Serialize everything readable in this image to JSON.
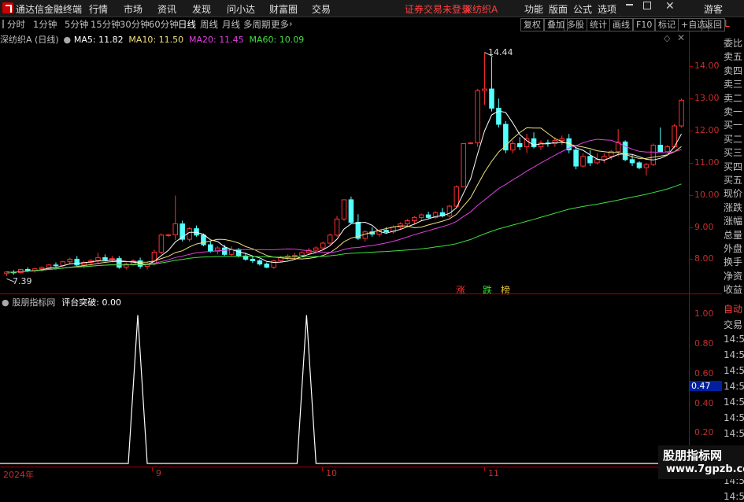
{
  "menubar": {
    "app_title": "通达信金融终端",
    "items": [
      "行情",
      "市场",
      "资讯",
      "发现",
      "问小达",
      "财富圈",
      "交易"
    ],
    "notice": "证券交易未登录",
    "stock_tab": "深纺织A",
    "right_items": [
      "功能",
      "版面",
      "公式",
      "选项"
    ],
    "user": "游客"
  },
  "toolbar": {
    "periods": [
      "分时",
      "1分钟",
      "5分钟",
      "15分钟",
      "30分钟",
      "60分钟",
      "日线",
      "周线",
      "月线",
      "多周期",
      "更多"
    ],
    "selected": "日线",
    "right_buttons": [
      "复权",
      "叠加",
      "多股",
      "统计",
      "画线",
      "F10",
      "标记",
      "+自选",
      "返回"
    ]
  },
  "main_chart": {
    "stock_label": "深纺织A (日线)",
    "ma": [
      {
        "name": "MA5",
        "value": "11.82",
        "color": "#ffffff"
      },
      {
        "name": "MA10",
        "value": "11.50",
        "color": "#f0e080"
      },
      {
        "name": "MA20",
        "value": "11.45",
        "color": "#e040e0"
      },
      {
        "name": "MA60",
        "value": "10.09",
        "color": "#40e040"
      }
    ],
    "high_label": "14.44",
    "low_label": "7.39",
    "markers": [
      {
        "text": "涨",
        "color": "#ff3030"
      },
      {
        "text": "跌",
        "color": "#30e030"
      },
      {
        "text": "榜",
        "color": "#e0c030"
      }
    ]
  },
  "indicator": {
    "name": "股朋指标网",
    "title": "评台突破",
    "value": "0.00",
    "current_label": "0.47"
  },
  "right_panel": {
    "items": [
      "委比",
      "卖五",
      "卖四",
      "卖三",
      "卖二",
      "卖一",
      "买一",
      "买二",
      "买三",
      "买四",
      "买五",
      "现价",
      "涨跌",
      "涨幅",
      "总量",
      "外盘",
      "换手",
      "净资",
      "收益"
    ],
    "lower_items": [
      "自动",
      "交易",
      "14:56",
      "14:56",
      "14:56",
      "14:56",
      "14:56",
      "14:56",
      "14:56",
      "14:56",
      "14:56",
      "14:56",
      "14:56"
    ],
    "corner": "L"
  },
  "bottom_axis": {
    "labels": [
      "2024年",
      "9",
      "10",
      "11"
    ]
  },
  "watermark": {
    "line1": "股朋指标网",
    "line2": "www.7gpzb.com"
  },
  "chart_data": [
    {
      "type": "candlestick",
      "title": "深纺织A (日线)",
      "ylim": [
        7.3,
        14.6
      ],
      "yticks": [
        8.0,
        9.0,
        10.0,
        11.0,
        12.0,
        13.0,
        14.0
      ],
      "high": 14.44,
      "low": 7.39,
      "candles": [
        [
          7.55,
          7.62,
          7.48,
          7.6
        ],
        [
          7.6,
          7.66,
          7.52,
          7.58
        ],
        [
          7.58,
          7.7,
          7.55,
          7.68
        ],
        [
          7.68,
          7.75,
          7.6,
          7.65
        ],
        [
          7.65,
          7.72,
          7.58,
          7.7
        ],
        [
          7.7,
          7.78,
          7.62,
          7.74
        ],
        [
          7.74,
          7.85,
          7.7,
          7.82
        ],
        [
          7.82,
          7.9,
          7.75,
          7.8
        ],
        [
          7.8,
          7.95,
          7.76,
          7.92
        ],
        [
          7.92,
          8.05,
          7.85,
          8.0
        ],
        [
          8.0,
          8.1,
          7.78,
          7.82
        ],
        [
          7.82,
          7.95,
          7.72,
          7.9
        ],
        [
          7.9,
          8.0,
          7.8,
          7.96
        ],
        [
          7.96,
          8.2,
          7.88,
          8.05
        ],
        [
          8.05,
          8.15,
          7.95,
          7.98
        ],
        [
          7.98,
          8.1,
          7.9,
          8.02
        ],
        [
          8.02,
          8.1,
          7.7,
          7.75
        ],
        [
          7.75,
          7.9,
          7.68,
          7.85
        ],
        [
          7.85,
          8.0,
          7.8,
          7.95
        ],
        [
          7.95,
          8.05,
          7.7,
          7.78
        ],
        [
          7.78,
          7.9,
          7.68,
          7.85
        ],
        [
          7.85,
          8.3,
          7.8,
          8.22
        ],
        [
          8.22,
          8.8,
          8.15,
          8.75
        ],
        [
          8.75,
          8.78,
          8.7,
          8.76
        ],
        [
          8.76,
          9.98,
          8.6,
          9.1
        ],
        [
          9.1,
          9.2,
          8.55,
          8.62
        ],
        [
          8.62,
          9.0,
          8.55,
          8.95
        ],
        [
          8.95,
          9.05,
          8.7,
          8.75
        ],
        [
          8.75,
          8.8,
          8.4,
          8.45
        ],
        [
          8.45,
          8.55,
          8.2,
          8.25
        ],
        [
          8.25,
          8.4,
          8.15,
          8.35
        ],
        [
          8.35,
          8.45,
          8.1,
          8.15
        ],
        [
          8.15,
          8.4,
          8.1,
          8.3
        ],
        [
          8.3,
          8.35,
          8.05,
          8.1
        ],
        [
          8.1,
          8.2,
          7.95,
          8.0
        ],
        [
          8.0,
          8.1,
          7.88,
          7.95
        ],
        [
          7.95,
          8.0,
          7.8,
          7.85
        ],
        [
          7.85,
          7.9,
          7.72,
          7.75
        ],
        [
          7.75,
          7.98,
          7.7,
          7.95
        ],
        [
          7.95,
          8.1,
          7.9,
          8.05
        ],
        [
          8.05,
          8.15,
          7.98,
          8.1
        ],
        [
          8.1,
          8.2,
          8.02,
          8.12
        ],
        [
          8.12,
          8.25,
          8.05,
          8.2
        ],
        [
          8.2,
          8.35,
          8.15,
          8.28
        ],
        [
          8.28,
          8.4,
          8.2,
          8.35
        ],
        [
          8.35,
          8.55,
          8.3,
          8.5
        ],
        [
          8.5,
          8.8,
          8.45,
          8.75
        ],
        [
          8.75,
          9.35,
          8.7,
          9.25
        ],
        [
          9.25,
          9.8,
          9.2,
          9.85
        ],
        [
          9.85,
          9.95,
          9.1,
          9.15
        ],
        [
          9.15,
          9.4,
          8.6,
          8.65
        ],
        [
          8.65,
          8.9,
          8.55,
          8.85
        ],
        [
          8.85,
          9.0,
          8.7,
          8.78
        ],
        [
          8.78,
          8.92,
          8.7,
          8.9
        ],
        [
          8.9,
          9.0,
          8.8,
          8.85
        ],
        [
          8.85,
          9.05,
          8.8,
          9.0
        ],
        [
          9.0,
          9.15,
          8.92,
          9.1
        ],
        [
          9.1,
          9.25,
          9.0,
          9.2
        ],
        [
          9.2,
          9.35,
          9.1,
          9.3
        ],
        [
          9.3,
          9.42,
          9.2,
          9.38
        ],
        [
          9.38,
          9.48,
          9.25,
          9.3
        ],
        [
          9.3,
          9.5,
          9.25,
          9.45
        ],
        [
          9.45,
          9.6,
          9.3,
          9.35
        ],
        [
          9.35,
          9.7,
          9.3,
          9.65
        ],
        [
          9.65,
          10.3,
          9.6,
          10.25
        ],
        [
          10.25,
          10.4,
          11.6,
          11.6
        ],
        [
          11.6,
          11.65,
          11.6,
          11.62
        ],
        [
          11.62,
          13.3,
          11.5,
          13.25
        ],
        [
          13.25,
          14.44,
          12.8,
          13.3
        ],
        [
          13.3,
          14.3,
          12.6,
          12.7
        ],
        [
          12.7,
          13.0,
          12.1,
          12.2
        ],
        [
          12.2,
          12.3,
          11.3,
          11.4
        ],
        [
          11.4,
          11.7,
          11.3,
          11.6
        ],
        [
          11.6,
          11.8,
          11.4,
          11.5
        ],
        [
          11.5,
          11.9,
          11.3,
          11.75
        ],
        [
          11.75,
          11.95,
          11.45,
          11.5
        ],
        [
          11.5,
          11.7,
          11.4,
          11.62
        ],
        [
          11.62,
          11.72,
          11.5,
          11.6
        ],
        [
          11.6,
          11.8,
          11.5,
          11.7
        ],
        [
          11.7,
          11.85,
          11.55,
          11.75
        ],
        [
          11.75,
          11.9,
          11.3,
          11.4
        ],
        [
          11.4,
          11.5,
          10.8,
          10.9
        ],
        [
          10.9,
          11.3,
          10.85,
          11.2
        ],
        [
          11.2,
          11.4,
          10.9,
          11.0
        ],
        [
          11.0,
          11.3,
          10.95,
          11.1
        ],
        [
          11.1,
          11.3,
          11.0,
          11.2
        ],
        [
          11.2,
          11.4,
          11.1,
          11.35
        ],
        [
          11.35,
          12.05,
          11.2,
          11.65
        ],
        [
          11.65,
          11.7,
          11.05,
          11.1
        ],
        [
          11.1,
          11.25,
          10.9,
          11.0
        ],
        [
          11.0,
          11.05,
          10.8,
          10.85
        ],
        [
          10.85,
          11.0,
          10.6,
          10.95
        ],
        [
          10.95,
          11.6,
          10.9,
          11.55
        ],
        [
          11.55,
          12.1,
          11.45,
          11.35
        ],
        [
          11.35,
          11.55,
          11.3,
          11.5
        ],
        [
          11.5,
          12.2,
          11.45,
          12.15
        ],
        [
          12.15,
          13.0,
          12.1,
          12.95
        ]
      ],
      "ma5_end": 11.82,
      "ma10_end": 11.5,
      "ma20_end": 11.45,
      "ma60_end": 10.09
    },
    {
      "type": "line",
      "title": "评台突破",
      "ylim": [
        0.0,
        1.05
      ],
      "yticks": [
        0.2,
        0.4,
        0.6,
        0.8,
        1.0
      ],
      "spikes": [
        {
          "position": 0.2,
          "value": 1.0
        },
        {
          "position": 0.445,
          "value": 1.0
        }
      ]
    }
  ]
}
